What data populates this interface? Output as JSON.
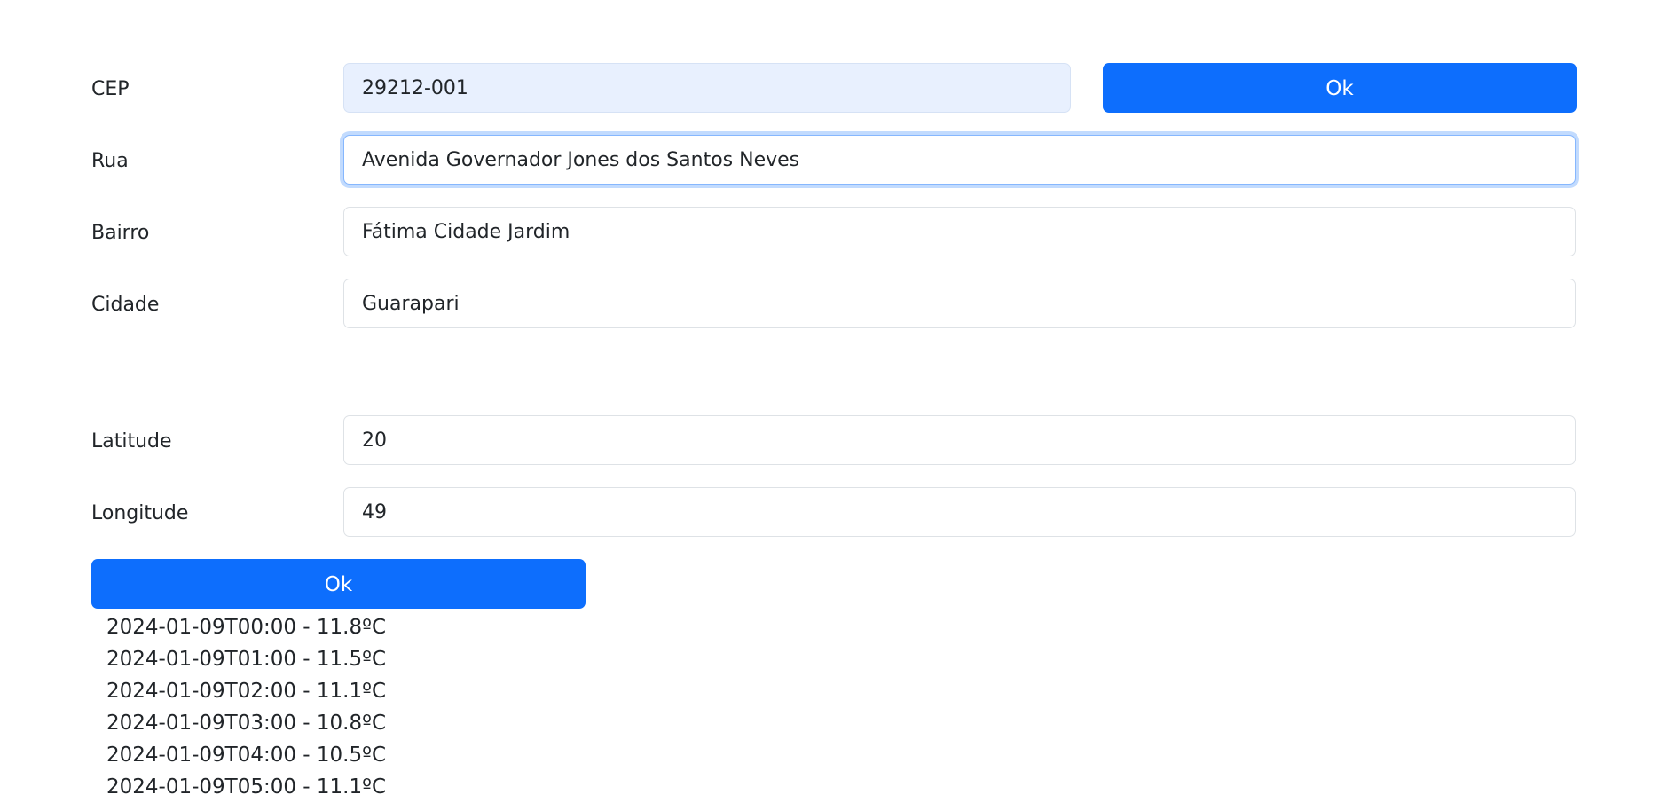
{
  "address_form": {
    "cep": {
      "label": "CEP",
      "value": "29212-001"
    },
    "rua": {
      "label": "Rua",
      "value": "Avenida Governador Jones dos Santos Neves"
    },
    "bairro": {
      "label": "Bairro",
      "value": "Fátima Cidade Jardim"
    },
    "cidade": {
      "label": "Cidade",
      "value": "Guarapari"
    },
    "ok_label": "Ok"
  },
  "coords_form": {
    "latitude": {
      "label": "Latitude",
      "value": "20"
    },
    "longitude": {
      "label": "Longitude",
      "value": "49"
    },
    "ok_label": "Ok"
  },
  "forecast": [
    "2024-01-09T00:00 - 11.8ºC",
    "2024-01-09T01:00 - 11.5ºC",
    "2024-01-09T02:00 - 11.1ºC",
    "2024-01-09T03:00 - 10.8ºC",
    "2024-01-09T04:00 - 10.5ºC",
    "2024-01-09T05:00 - 11.1ºC"
  ],
  "colors": {
    "primary": "#0d6efd",
    "autofill_bg": "#e8f0fe",
    "border": "#dee2e6",
    "focus_ring": "#86b7fe"
  }
}
